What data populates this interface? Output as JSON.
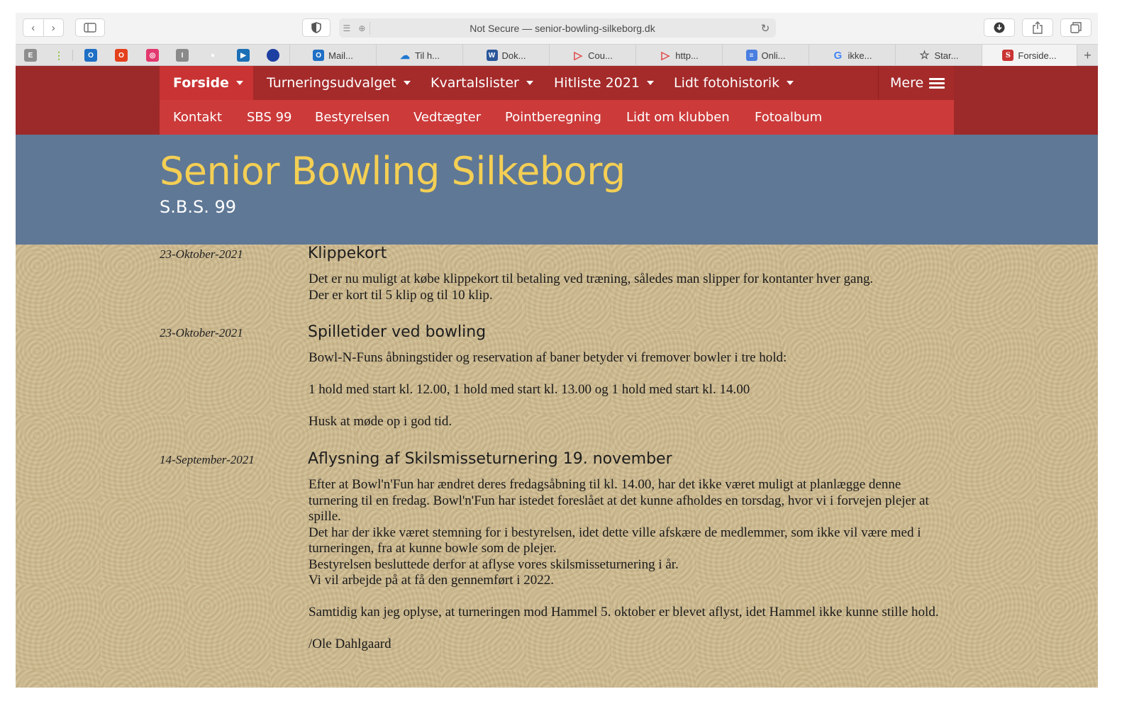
{
  "browser": {
    "url_text": "Not Secure — senior-bowling-silkeborg.dk",
    "pinned_tabs": [
      {
        "icon": "e-app-icon",
        "label": "E",
        "color": "#8e8e8e"
      },
      {
        "icon": "kebab-app-icon",
        "label": "⋮",
        "color": "#8bbf3a"
      },
      {
        "icon": "outlook-icon",
        "label": "O",
        "color": "#1f6fc4"
      },
      {
        "icon": "office-icon",
        "label": "O",
        "color": "#e3411c"
      },
      {
        "icon": "creative-cloud-icon",
        "label": "◎",
        "color": "#e2386d"
      },
      {
        "icon": "bar-app-icon",
        "label": "I",
        "color": "#8a8a8a"
      },
      {
        "icon": "chrome-like-icon",
        "label": "●",
        "color": "#e5a02c"
      },
      {
        "icon": "video-app-icon",
        "label": "▶",
        "color": "#1b6fb5"
      },
      {
        "icon": "circle-app-icon",
        "label": "●",
        "color": "#1d3fa1"
      }
    ],
    "tabs": [
      {
        "label": "Mail...",
        "icon": "outlook-mail-icon",
        "color": "#1f6fc4",
        "glyph": "O"
      },
      {
        "label": "Til h...",
        "icon": "onedrive-icon",
        "color": "#1f78d1",
        "glyph": "☁"
      },
      {
        "label": "Dok...",
        "icon": "word-icon",
        "color": "#2b579a",
        "glyph": "W"
      },
      {
        "label": "Cou...",
        "icon": "triangle-app-icon",
        "color": "#e04545",
        "glyph": "▷"
      },
      {
        "label": "http...",
        "icon": "triangle-app-icon",
        "color": "#e04545",
        "glyph": "▷"
      },
      {
        "label": "Onli...",
        "icon": "docs-icon",
        "color": "#4a7fe0",
        "glyph": "≡"
      },
      {
        "label": "ikke...",
        "icon": "google-icon",
        "color": "#ffffff",
        "glyph": "G"
      },
      {
        "label": "Star...",
        "icon": "star-icon",
        "color": "#ffffff",
        "glyph": "☆"
      },
      {
        "label": "Forside...",
        "icon": "site-s-icon",
        "color": "#c93333",
        "glyph": "S"
      }
    ]
  },
  "nav": {
    "main": [
      {
        "label": "Forside",
        "active": true,
        "caret": true
      },
      {
        "label": "Turneringsudvalget",
        "active": false,
        "caret": true
      },
      {
        "label": "Kvartalslister",
        "active": false,
        "caret": true
      },
      {
        "label": "Hitliste 2021",
        "active": false,
        "caret": true
      },
      {
        "label": "Lidt fotohistorik",
        "active": false,
        "caret": true
      }
    ],
    "more_label": "Mere",
    "sub": [
      "Kontakt",
      "SBS 99",
      "Bestyrelsen",
      "Vedtægter",
      "Pointberegning",
      "Lidt om klubben",
      "Fotoalbum"
    ]
  },
  "banner": {
    "title": "Senior Bowling Silkeborg",
    "subtitle": "S.B.S. 99"
  },
  "posts": [
    {
      "date": "23-Oktober-2021",
      "title": "Klippekort",
      "paragraphs": [
        {
          "text": "Det er nu muligt at købe klippekort til betaling ved træning, således man slipper for kontanter hver gang.",
          "gap": false
        },
        {
          "text": "Der er kort til 5 klip og til 10 klip.",
          "gap": false
        }
      ]
    },
    {
      "date": "23-Oktober-2021",
      "title": "Spilletider ved bowling",
      "paragraphs": [
        {
          "text": "Bowl-N-Funs åbningstider og reservation af baner betyder vi fremover bowler i tre hold:",
          "gap": false
        },
        {
          "text": "1 hold med start kl. 12.00, 1 hold med start kl. 13.00 og 1 hold med start kl. 14.00",
          "gap": true
        },
        {
          "text": "Husk at møde op i god tid.",
          "gap": true
        }
      ]
    },
    {
      "date": "14-September-2021",
      "title": "Aflysning af Skilsmisseturnering 19. november",
      "paragraphs": [
        {
          "text": "Efter at Bowl'n'Fun har ændret deres fredagsåbning til kl. 14.00, har det ikke været muligt at planlægge denne turnering til en fredag. Bowl'n'Fun har istedet foreslået at det kunne afholdes en torsdag, hvor vi i forvejen plejer at spille.",
          "gap": false
        },
        {
          "text": "Det har der ikke været stemning for i bestyrelsen, idet dette ville afskære de medlemmer, som ikke vil være med i turneringen, fra at kunne bowle som de plejer.",
          "gap": false
        },
        {
          "text": "Bestyrelsen besluttede derfor at aflyse vores skilsmisseturnering i år.",
          "gap": false
        },
        {
          "text": "Vi vil arbejde på at få den gennemført i 2022.",
          "gap": false
        },
        {
          "text": "Samtidig kan jeg oplyse, at turneringen mod Hammel 5. oktober er blevet aflyst, idet Hammel ikke kunne stille hold.",
          "gap": true
        },
        {
          "text": "/Ole Dahlgaard",
          "gap": true
        }
      ]
    }
  ]
}
